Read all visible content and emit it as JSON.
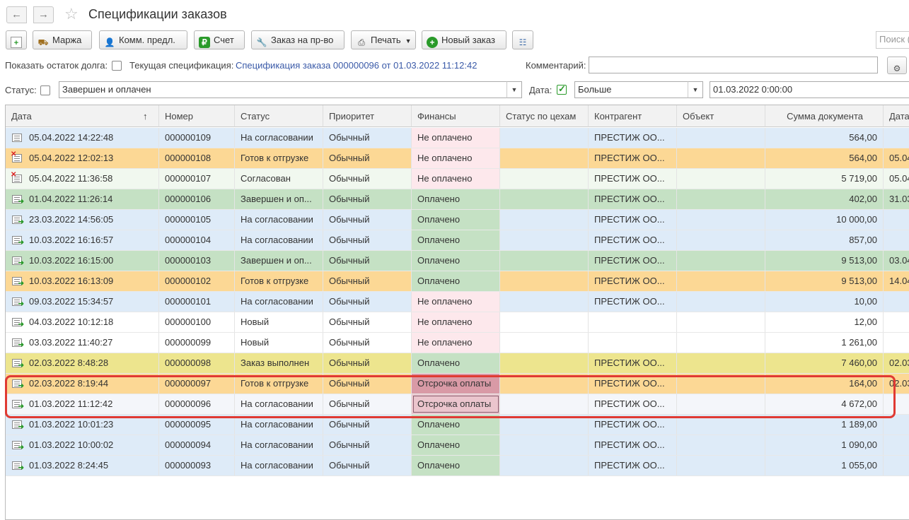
{
  "title": "Спецификации заказов",
  "toolbar": {
    "buttons": [
      {
        "label": "",
        "icon": "add-doc-icon"
      },
      {
        "label": "Маржа",
        "icon": "margin-icon"
      },
      {
        "label": "Комм. предл.",
        "icon": "offer-icon"
      },
      {
        "label": "Счет",
        "icon": "ruble-icon"
      },
      {
        "label": "Заказ на пр-во",
        "icon": "wrench-icon"
      },
      {
        "label": "Печать",
        "icon": "print-icon"
      },
      {
        "label": "Новый заказ",
        "icon": "plus-circle-icon"
      },
      {
        "label": "",
        "icon": "list-icon"
      }
    ],
    "search_placeholder": "Поиск ("
  },
  "filters": {
    "show_debt_label": "Показать остаток долга:",
    "current_spec_label": "Текущая спецификация:",
    "current_spec_link": "Спецификация заказа 000000096 от 01.03.2022 11:12:42",
    "comment_label": "Комментарий:",
    "comment_value": "",
    "status_label": "Статус:",
    "status_value": "Завершен и оплачен",
    "date_label": "Дата:",
    "date_checked": true,
    "date_cond": "Больше",
    "date_value": "01.03.2022  0:00:00"
  },
  "columns": [
    "Дата",
    "Номер",
    "Статус",
    "Приоритет",
    "Финансы",
    "Статус по цехам",
    "Контрагент",
    "Объект",
    "Сумма документа",
    "Дата"
  ],
  "sort_indicator": "↑",
  "rows": [
    {
      "date": "05.04.2022 14:22:48",
      "num": "000000109",
      "status": "На согласовании",
      "prio": "Обычный",
      "fin": "Не оплачено",
      "contr": "ПРЕСТИЖ ОО...",
      "sum": "564,00",
      "date2": "",
      "bg": "#deebf8",
      "finbg": "#fde8ec",
      "mark": ""
    },
    {
      "date": "05.04.2022 12:02:13",
      "num": "000000108",
      "status": "Готов к отгрузке",
      "prio": "Обычный",
      "fin": "Не оплачено",
      "contr": "ПРЕСТИЖ ОО...",
      "sum": "564,00",
      "date2": "05.04",
      "bg": "#fcd895",
      "finbg": "#fde8ec",
      "mark": "x"
    },
    {
      "date": "05.04.2022 11:36:58",
      "num": "000000107",
      "status": "Согласован",
      "prio": "Обычный",
      "fin": "Не оплачено",
      "contr": "ПРЕСТИЖ ОО...",
      "sum": "5 719,00",
      "date2": "05.04",
      "bg": "#f1f8ef",
      "finbg": "#fde8ec",
      "mark": "x"
    },
    {
      "date": "01.04.2022 11:26:14",
      "num": "000000106",
      "status": "Завершен и оп...",
      "prio": "Обычный",
      "fin": "Оплачено",
      "contr": "ПРЕСТИЖ ОО...",
      "sum": "402,00",
      "date2": "31.03",
      "bg": "#c5e1c4",
      "finbg": "#c5e1c4",
      "mark": "v"
    },
    {
      "date": "23.03.2022 14:56:05",
      "num": "000000105",
      "status": "На согласовании",
      "prio": "Обычный",
      "fin": "Оплачено",
      "contr": "ПРЕСТИЖ ОО...",
      "sum": "10 000,00",
      "date2": "",
      "bg": "#deebf8",
      "finbg": "#c5e1c4",
      "mark": "v"
    },
    {
      "date": "10.03.2022 16:16:57",
      "num": "000000104",
      "status": "На согласовании",
      "prio": "Обычный",
      "fin": "Оплачено",
      "contr": "ПРЕСТИЖ ОО...",
      "sum": "857,00",
      "date2": "",
      "bg": "#deebf8",
      "finbg": "#c5e1c4",
      "mark": "v"
    },
    {
      "date": "10.03.2022 16:15:00",
      "num": "000000103",
      "status": "Завершен и оп...",
      "prio": "Обычный",
      "fin": "Оплачено",
      "contr": "ПРЕСТИЖ ОО...",
      "sum": "9 513,00",
      "date2": "03.04",
      "bg": "#c5e1c4",
      "finbg": "#c5e1c4",
      "mark": "v"
    },
    {
      "date": "10.03.2022 16:13:09",
      "num": "000000102",
      "status": "Готов к отгрузке",
      "prio": "Обычный",
      "fin": "Оплачено",
      "contr": "ПРЕСТИЖ ОО...",
      "sum": "9 513,00",
      "date2": "14.04",
      "bg": "#fcd895",
      "finbg": "#c5e1c4",
      "mark": "v"
    },
    {
      "date": "09.03.2022 15:34:57",
      "num": "000000101",
      "status": "На согласовании",
      "prio": "Обычный",
      "fin": "Не оплачено",
      "contr": "ПРЕСТИЖ ОО...",
      "sum": "10,00",
      "date2": "",
      "bg": "#deebf8",
      "finbg": "#fde8ec",
      "mark": "v"
    },
    {
      "date": "04.03.2022 10:12:18",
      "num": "000000100",
      "status": "Новый",
      "prio": "Обычный",
      "fin": "Не оплачено",
      "contr": "",
      "sum": "12,00",
      "date2": "",
      "bg": "#ffffff",
      "finbg": "#fde8ec",
      "mark": "v"
    },
    {
      "date": "03.03.2022 11:40:27",
      "num": "000000099",
      "status": "Новый",
      "prio": "Обычный",
      "fin": "Не оплачено",
      "contr": "",
      "sum": "1 261,00",
      "date2": "",
      "bg": "#ffffff",
      "finbg": "#fde8ec",
      "mark": "v"
    },
    {
      "date": "02.03.2022 8:48:28",
      "num": "000000098",
      "status": "Заказ выполнен",
      "prio": "Обычный",
      "fin": "Оплачено",
      "contr": "ПРЕСТИЖ ОО...",
      "sum": "7 460,00",
      "date2": "02.03",
      "bg": "#ede58e",
      "finbg": "#c5e1c4",
      "mark": "v"
    },
    {
      "date": "02.03.2022 8:19:44",
      "num": "000000097",
      "status": "Готов к отгрузке",
      "prio": "Обычный",
      "fin": "Отсрочка оплаты",
      "contr": "ПРЕСТИЖ ОО...",
      "sum": "164,00",
      "date2": "02.03",
      "bg": "#fcd895",
      "finbg": "#d99aa6",
      "mark": "v"
    },
    {
      "date": "01.03.2022 11:12:42",
      "num": "000000096",
      "status": "На согласовании",
      "prio": "Обычный",
      "fin": "Отсрочка оплаты",
      "contr": "ПРЕСТИЖ ОО...",
      "sum": "4 672,00",
      "date2": "",
      "bg": "#f4f6fa",
      "finbg": "#ebc5cd",
      "mark": "v",
      "selected": true
    },
    {
      "date": "01.03.2022 10:01:23",
      "num": "000000095",
      "status": "На согласовании",
      "prio": "Обычный",
      "fin": "Оплачено",
      "contr": "ПРЕСТИЖ ОО...",
      "sum": "1 189,00",
      "date2": "",
      "bg": "#deebf8",
      "finbg": "#c5e1c4",
      "mark": "v"
    },
    {
      "date": "01.03.2022 10:00:02",
      "num": "000000094",
      "status": "На согласовании",
      "prio": "Обычный",
      "fin": "Оплачено",
      "contr": "ПРЕСТИЖ ОО...",
      "sum": "1 090,00",
      "date2": "",
      "bg": "#deebf8",
      "finbg": "#c5e1c4",
      "mark": "v"
    },
    {
      "date": "01.03.2022 8:24:45",
      "num": "000000093",
      "status": "На согласовании",
      "prio": "Обычный",
      "fin": "Оплачено",
      "contr": "ПРЕСТИЖ ОО...",
      "sum": "1 055,00",
      "date2": "",
      "bg": "#deebf8",
      "finbg": "#c5e1c4",
      "mark": "v"
    }
  ]
}
